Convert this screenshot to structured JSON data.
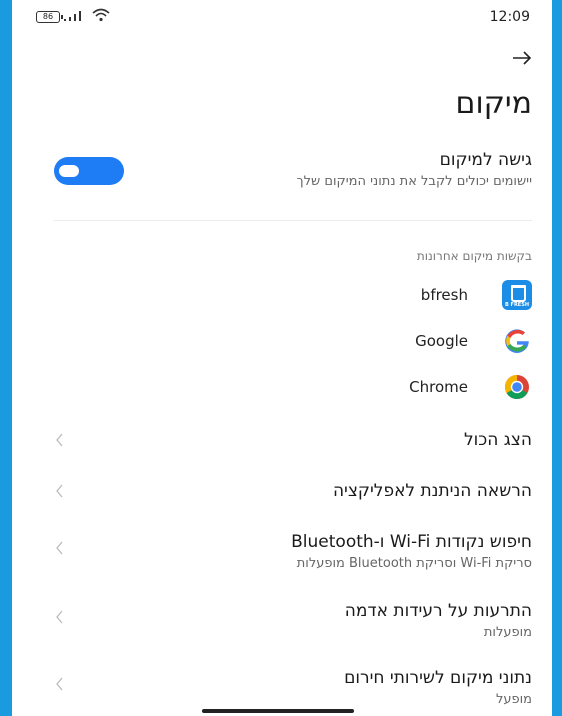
{
  "status_bar": {
    "battery": "86",
    "time": "12:09"
  },
  "page": {
    "title": "מיקום"
  },
  "location_access": {
    "title": "גישה למיקום",
    "subtitle": "יישומים יכולים לקבל את נתוני המיקום שלך",
    "enabled": true
  },
  "recent_requests": {
    "header": "בקשות מיקום אחרונות",
    "apps": [
      {
        "name": "bfresh",
        "icon": "bfresh-icon",
        "icon_label": "B FRESH"
      },
      {
        "name": "Google",
        "icon": "google-icon"
      },
      {
        "name": "Chrome",
        "icon": "chrome-icon"
      }
    ]
  },
  "items": [
    {
      "title": "הצג הכול"
    },
    {
      "title": "הרשאה הניתנת לאפליקציה"
    },
    {
      "title": "חיפוש נקודות Wi-Fi ו-Bluetooth",
      "subtitle": "סריקת Wi-Fi וסריקת Bluetooth מופעלות"
    },
    {
      "title": "התרעות על רעידות אדמה",
      "subtitle": "מופעלות"
    },
    {
      "title": "נתוני מיקום לשירותי חירום",
      "subtitle": "מופעל"
    }
  ],
  "colors": {
    "accent": "#1e7cf5",
    "frame": "#1a9be0"
  }
}
